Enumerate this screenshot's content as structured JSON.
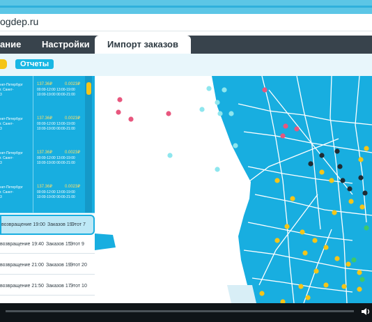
{
  "browser": {
    "url": "ogdep.ru"
  },
  "tabs": [
    "ание",
    "Настройки",
    "Импорт заказов"
  ],
  "toolbar": {
    "reports_label": "Отчеты"
  },
  "routes": [
    {
      "addr": [
        "нкт-Петербург",
        "г. Санкт-",
        "3"
      ],
      "price": "137.36₽",
      "value": "0.0023₽",
      "sched": [
        "00:00-12:00 13:00-19:00",
        "10:00-19:00 00:00-21:00"
      ]
    },
    {
      "addr": [
        "нкт-Петербург",
        "г. Санкт-",
        "3"
      ],
      "price": "137.36₽",
      "value": "0.0023₽",
      "sched": [
        "00:00-12:00 13:00-19:00",
        "10:00-19:00 00:00-21:00"
      ]
    },
    {
      "addr": [
        "нкт-Петербург",
        "г. Санкт-",
        "3"
      ],
      "price": "137.36₽",
      "value": "0.0023₽",
      "sched": [
        "00:00-12:00 13:00-19:00",
        "10:00-19:00 00:00-21:00"
      ]
    },
    {
      "addr": [
        "нкт-Петербург",
        "г. Санкт-",
        "3"
      ],
      "price": "137.36₽",
      "value": "0.0023₽",
      "sched": [
        "00:00-12:00 13:00-19:00",
        "10:00-19:00 00:00-21:00"
      ]
    }
  ],
  "orders": [
    {
      "return": "возвращение 19:00",
      "orders": "Заказов 19",
      "stops": "Этот 7",
      "selected": true
    },
    {
      "return": "возвращение 19:40",
      "orders": "Заказов 15",
      "stops": "Этот 9",
      "selected": false
    },
    {
      "return": "возвращение 21:00",
      "orders": "Заказов 19",
      "stops": "Этот 20",
      "selected": false
    },
    {
      "return": "возвращение 21:50",
      "orders": "Заказов 17",
      "stops": "Этот 10",
      "selected": false
    }
  ],
  "colors": {
    "accent": "#18aee0",
    "tabbar": "#38434c",
    "yellow": "#f5c518",
    "pink": "#e8577e",
    "dark": "#1f2b33",
    "green": "#3ec86a",
    "cyan": "#8ee6ee"
  },
  "player": {
    "progress": 0
  }
}
